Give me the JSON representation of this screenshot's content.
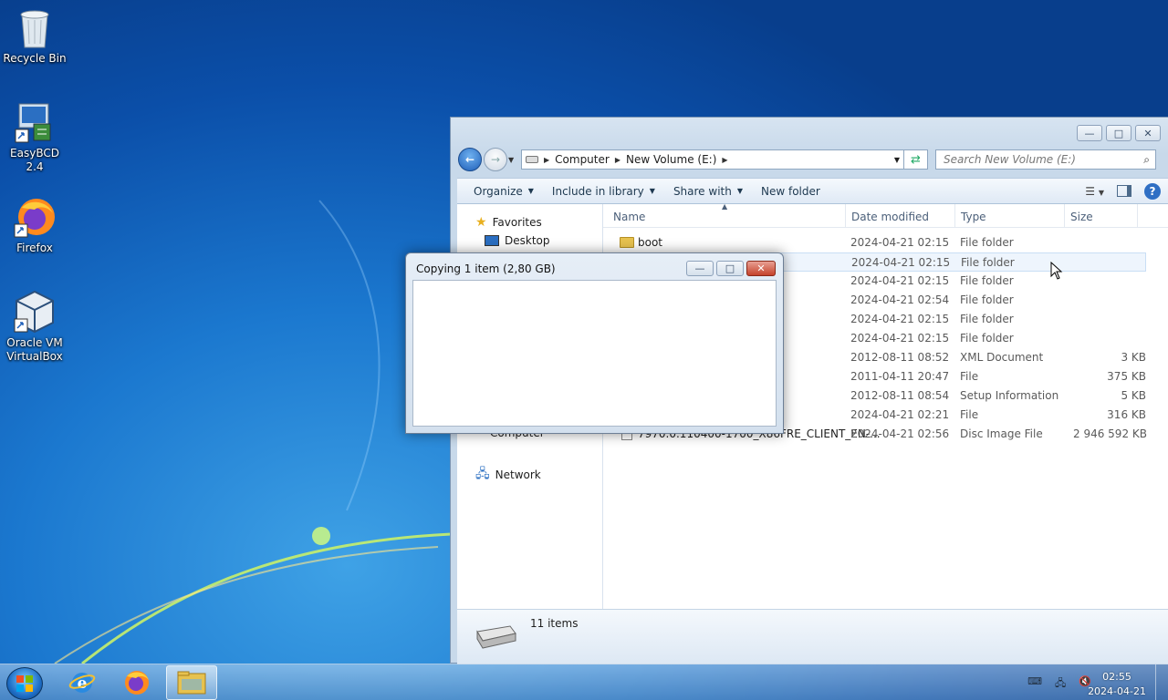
{
  "desktop": {
    "icons": [
      {
        "label": "Recycle Bin"
      },
      {
        "label": "EasyBCD 2.4"
      },
      {
        "label": "Firefox"
      },
      {
        "label_line1": "Oracle VM",
        "label_line2": "VirtualBox"
      }
    ]
  },
  "explorer": {
    "breadcrumb": [
      "Computer",
      "New Volume (E:)"
    ],
    "search_placeholder": "Search New Volume (E:)",
    "toolbar": {
      "organize": "Organize",
      "include": "Include in library",
      "share": "Share with",
      "new_folder": "New folder"
    },
    "nav": {
      "favorites": "Favorites",
      "desktop": "Desktop",
      "computer": "Computer",
      "network": "Network"
    },
    "columns": {
      "name": "Name",
      "date": "Date modified",
      "type": "Type",
      "size": "Size"
    },
    "rows": [
      {
        "name": "boot",
        "date": "2024-04-21 02:15",
        "type": "File folder",
        "size": ""
      },
      {
        "name": "",
        "date": "2024-04-21 02:15",
        "type": "File folder",
        "size": ""
      },
      {
        "name": "",
        "date": "2024-04-21 02:15",
        "type": "File folder",
        "size": ""
      },
      {
        "name": "",
        "date": "2024-04-21 02:54",
        "type": "File folder",
        "size": ""
      },
      {
        "name": "",
        "date": "2024-04-21 02:15",
        "type": "File folder",
        "size": ""
      },
      {
        "name": "",
        "date": "2024-04-21 02:15",
        "type": "File folder",
        "size": ""
      },
      {
        "name": "",
        "date": "2012-08-11 08:52",
        "type": "XML Document",
        "size": "3 KB"
      },
      {
        "name": "",
        "date": "2011-04-11 20:47",
        "type": "File",
        "size": "375 KB"
      },
      {
        "name": "",
        "date": "2012-08-11 08:54",
        "type": "Setup Information",
        "size": "5 KB"
      },
      {
        "name": "",
        "date": "2024-04-21 02:21",
        "type": "File",
        "size": "316 KB"
      },
      {
        "name": "7970.0.110400-1700_X86FRE_CLIENT_EN-...",
        "date": "2024-04-21 02:56",
        "type": "Disc Image File",
        "size": "2 946 592 KB"
      }
    ],
    "status": "11 items"
  },
  "dialog": {
    "title": "Copying 1 item (2,80 GB)"
  },
  "taskbar": {
    "time": "02:55",
    "date": "2024-04-21"
  }
}
